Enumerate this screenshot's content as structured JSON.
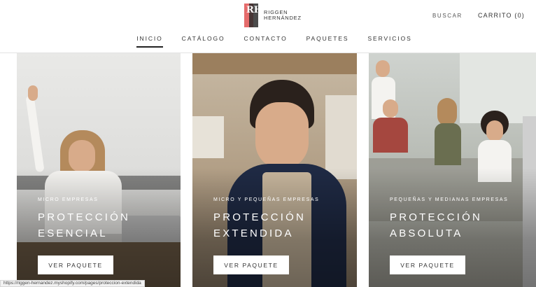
{
  "header": {
    "logo": {
      "monogram": "RH",
      "line1": "RIGGEN",
      "line2": "HERNÁNDEZ",
      "tagline": ""
    },
    "search_label": "BUSCAR",
    "cart_label": "CARRITO (0)"
  },
  "nav": {
    "items": [
      {
        "label": "INICIO",
        "active": true
      },
      {
        "label": "CATÁLOGO"
      },
      {
        "label": "CONTACTO"
      },
      {
        "label": "PAQUETES"
      },
      {
        "label": "SERVICIOS"
      }
    ]
  },
  "cards": [
    {
      "kicker": "MICRO EMPRESAS",
      "title_line1": "PROTECCIÓN",
      "title_line2": "ESENCIAL",
      "button": "VER PAQUETE"
    },
    {
      "kicker": "MICRO Y PEQUEÑAS EMPRESAS",
      "title_line1": "PROTECCIÓN",
      "title_line2": "EXTENDIDA",
      "button": "VER PAQUETE"
    },
    {
      "kicker": "PEQUEÑAS Y MEDIANAS EMPRESAS",
      "title_line1": "PROTECCIÓN",
      "title_line2": "ABSOLUTA",
      "button": "VER PAQUETE"
    }
  ],
  "status_bar": {
    "url": "https://riggen-hernandez.myshopify.com/pages/proteccion-extendida"
  },
  "colors": {
    "logo_accent": "#e56b6b",
    "text": "#333333",
    "button_bg": "#ffffff"
  }
}
